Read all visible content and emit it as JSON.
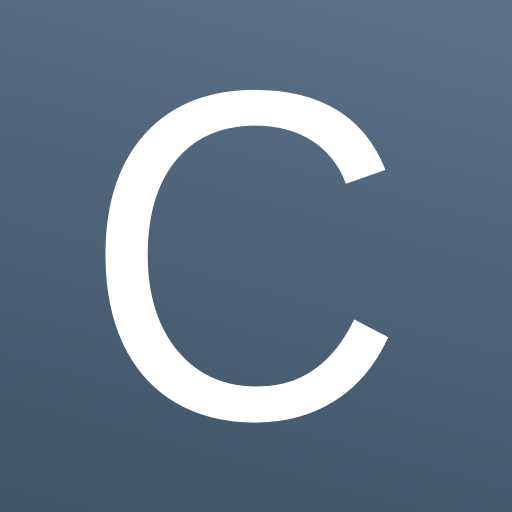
{
  "app_icon": {
    "letter": "C",
    "colors": {
      "background_top": "#5d7289",
      "background_bottom": "#3f5467",
      "letter": "#ffffff"
    }
  }
}
